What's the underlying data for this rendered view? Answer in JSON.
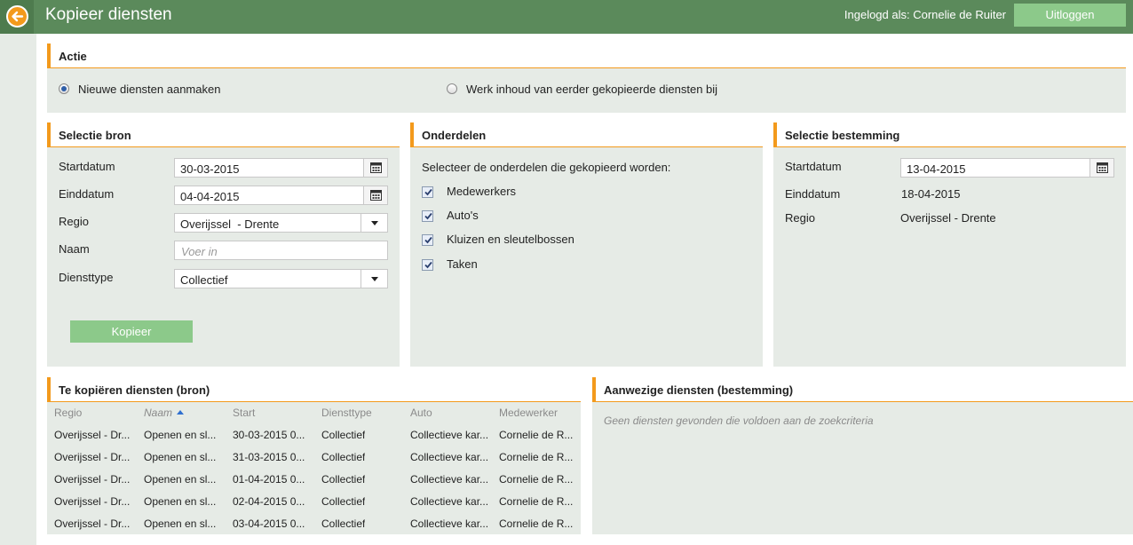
{
  "header": {
    "title": "Kopieer diensten",
    "login_label": "Ingelogd als: Cornelie de Ruiter",
    "logout_label": "Uitloggen"
  },
  "actie": {
    "title": "Actie",
    "option_new": "Nieuwe diensten aanmaken",
    "option_update": "Werk inhoud van eerder gekopieerde diensten bij",
    "selected": "option_new"
  },
  "bron": {
    "title": "Selectie bron",
    "startdatum_label": "Startdatum",
    "startdatum_value": "30-03-2015",
    "einddatum_label": "Einddatum",
    "einddatum_value": "04-04-2015",
    "regio_label": "Regio",
    "regio_value": "Overijssel  - Drente",
    "naam_label": "Naam",
    "naam_placeholder": "Voer in",
    "diensttype_label": "Diensttype",
    "diensttype_value": "Collectief",
    "kopieer_label": "Kopieer"
  },
  "onderdelen": {
    "title": "Onderdelen",
    "intro": "Selecteer de onderdelen die gekopieerd worden:",
    "items": [
      {
        "label": "Medewerkers",
        "checked": true
      },
      {
        "label": "Auto's",
        "checked": true
      },
      {
        "label": "Kluizen en sleutelbossen",
        "checked": true
      },
      {
        "label": "Taken",
        "checked": true
      }
    ]
  },
  "bestemming": {
    "title": "Selectie bestemming",
    "startdatum_label": "Startdatum",
    "startdatum_value": "13-04-2015",
    "einddatum_label": "Einddatum",
    "einddatum_value": "18-04-2015",
    "regio_label": "Regio",
    "regio_value": "Overijssel - Drente"
  },
  "bron_table": {
    "title": "Te kopiëren diensten (bron)",
    "columns": [
      "Regio",
      "Naam",
      "Start",
      "Diensttype",
      "Auto",
      "Medewerker"
    ],
    "sorted_column": "Naam",
    "rows": [
      [
        "Overijssel - Dr...",
        "Openen en sl...",
        "30-03-2015 0...",
        "Collectief",
        "Collectieve kar...",
        "Cornelie de R..."
      ],
      [
        "Overijssel - Dr...",
        "Openen en sl...",
        "31-03-2015 0...",
        "Collectief",
        "Collectieve kar...",
        "Cornelie de R..."
      ],
      [
        "Overijssel - Dr...",
        "Openen en sl...",
        "01-04-2015 0...",
        "Collectief",
        "Collectieve kar...",
        "Cornelie de R..."
      ],
      [
        "Overijssel - Dr...",
        "Openen en sl...",
        "02-04-2015 0...",
        "Collectief",
        "Collectieve kar...",
        "Cornelie de R..."
      ],
      [
        "Overijssel - Dr...",
        "Openen en sl...",
        "03-04-2015 0...",
        "Collectief",
        "Collectieve kar...",
        "Cornelie de R..."
      ]
    ]
  },
  "bestemming_table": {
    "title": "Aanwezige diensten (bestemming)",
    "empty_message": "Geen diensten gevonden die voldoen aan de zoekcriteria"
  },
  "colors": {
    "header_green": "#5b8a5b",
    "button_green": "#8cc98a",
    "accent_orange": "#f39a1c",
    "panel_bg": "#e6ebe6"
  }
}
